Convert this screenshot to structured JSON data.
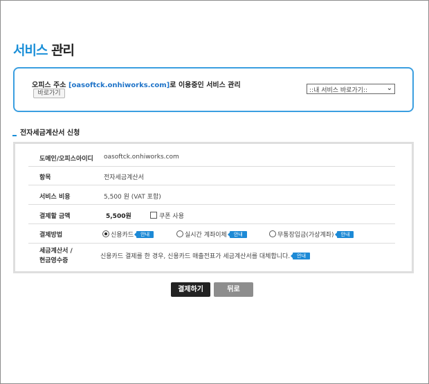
{
  "page": {
    "title_accent": "서비스",
    "title_rest": "관리"
  },
  "notice": {
    "prefix": "오피스 주소 ",
    "domain": "[oasoftck.onhiworks.com]",
    "suffix": "로 이용중인 서비스 관리",
    "go_button": "바로가기",
    "quick_select": "::내 서비스 바로가기::"
  },
  "section": {
    "title": "전자세금계산서 신청"
  },
  "form": {
    "domain_label": "도메인/오피스아이디",
    "domain_value": "oasoftck.onhiworks.com",
    "item_label": "항목",
    "item_value": "전자세금계산서",
    "cost_label": "서비스 비용",
    "cost_value": "5,500 원 (VAT 포함)",
    "amount_label": "결제할 금액",
    "amount_value": "5,500원",
    "coupon_label": "쿠폰 사용",
    "method_label": "결제방법",
    "methods": [
      {
        "label": "신용카드",
        "selected": true,
        "tag": "안내"
      },
      {
        "label": "실시간 계좌이체",
        "selected": false,
        "tag": "안내"
      },
      {
        "label": "무통장입금(가상계좌)",
        "selected": false,
        "tag": "안내"
      }
    ],
    "receipt_label_1": "세금계산서 /",
    "receipt_label_2": "현금영수증",
    "receipt_value": "신용카드 결제를 한 경우, 신용카드 매출전표가 세금계산서를 대체합니다.",
    "receipt_tag": "안내"
  },
  "buttons": {
    "pay": "결제하기",
    "back": "뒤로"
  },
  "colors": {
    "accent": "#1a8fd8",
    "border_blue": "#3a9ee0",
    "pay_button": "#222222",
    "back_button": "#8d8d8d"
  }
}
